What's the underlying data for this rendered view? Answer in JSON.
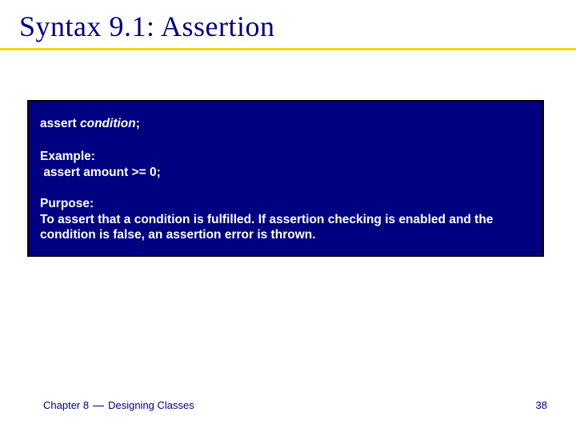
{
  "title": "Syntax 9.1: Assertion",
  "box": {
    "syntax_prefix": "assert ",
    "syntax_italic": "condition",
    "syntax_suffix": ";",
    "example_label": "Example:",
    "example_code": "assert amount >= 0;",
    "purpose_label": "Purpose:",
    "purpose_text": "To assert that a condition is fulfilled. If assertion checking is enabled and the condition is false, an assertion error is thrown."
  },
  "footer": {
    "chapter_prefix": "Chapter 8",
    "chapter_suffix": "Designing Classes",
    "page_number": "38"
  }
}
